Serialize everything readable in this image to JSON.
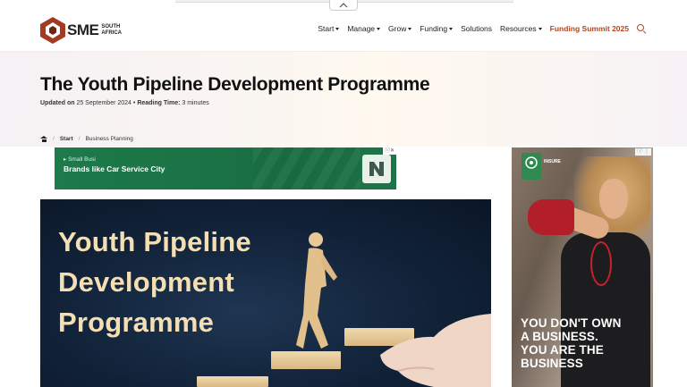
{
  "header": {
    "logo": {
      "brand": "SME",
      "sub_line1": "SOUTH",
      "sub_line2": "AFRICA"
    },
    "nav": [
      {
        "label": "Start",
        "dropdown": true
      },
      {
        "label": "Manage",
        "dropdown": true
      },
      {
        "label": "Grow",
        "dropdown": true
      },
      {
        "label": "Funding",
        "dropdown": true
      },
      {
        "label": "Solutions",
        "dropdown": false
      },
      {
        "label": "Resources",
        "dropdown": true
      },
      {
        "label": "Funding Summit 2025",
        "dropdown": false,
        "highlight": true
      }
    ],
    "search_icon": "search-icon",
    "colors": {
      "accent": "#b5441f",
      "logo_red": "#a33a22"
    }
  },
  "article": {
    "title": "The Youth Pipeline Development Programme",
    "updated_label": "Updated on",
    "updated_date": "25 September 2024",
    "separator": "•",
    "reading_label": "Reading Time:",
    "reading_value": "3 minutes"
  },
  "breadcrumb": {
    "home_icon": "home-icon",
    "items": [
      "Start",
      "Business Planning"
    ],
    "separator": "/"
  },
  "banner_ad": {
    "small_text": "Small Busi",
    "title": "Brands like Car Service City",
    "info_icon": "ⓘ✕",
    "color": "#1d7a4a"
  },
  "featured_image": {
    "line1": "Youth Pipeline",
    "line2": "Development",
    "line3": "Programme"
  },
  "side_ad": {
    "logo_text": "INSURE",
    "headline_line1": "YOU DON'T OWN",
    "headline_line2": "A BUSINESS.",
    "headline_line3": "YOU ARE THE",
    "headline_line4": "BUSINESS",
    "info_icon": "ⓘ ⋮"
  }
}
